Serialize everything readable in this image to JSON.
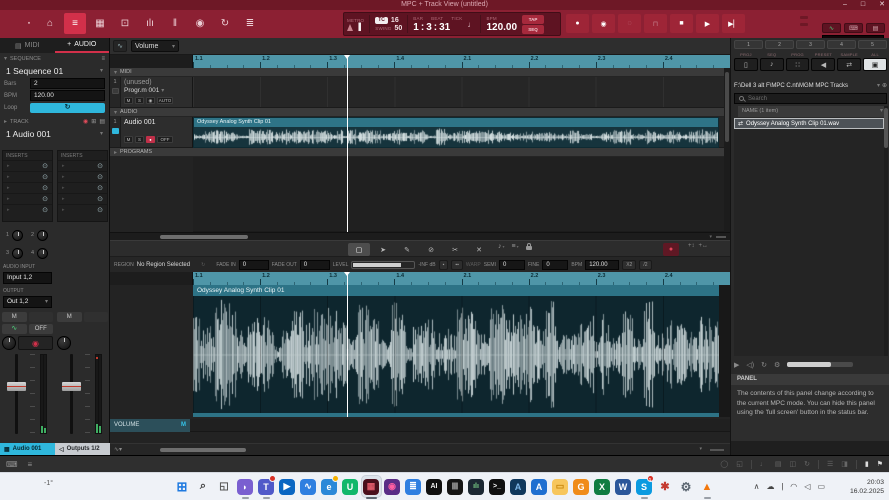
{
  "window": {
    "title": "MPC + Track View (untitled)",
    "minimize": "–",
    "maximize": "□",
    "close": "✕"
  },
  "toolbar": {
    "modes": [
      {
        "name": "main-menu",
        "glyph": "▪",
        "active": false
      },
      {
        "name": "home",
        "glyph": "⌂",
        "active": false
      },
      {
        "name": "track-view",
        "glyph": "≡",
        "active": true
      },
      {
        "name": "pad-grid",
        "glyph": "▦",
        "active": false
      },
      {
        "name": "sample-edit",
        "glyph": "⊡",
        "active": false
      },
      {
        "name": "step-sequencer",
        "glyph": "ılı",
        "active": false
      },
      {
        "name": "channel-mixer",
        "glyph": "‖",
        "active": false
      },
      {
        "name": "disc",
        "glyph": "◉",
        "active": false
      },
      {
        "name": "cycle",
        "glyph": "↻",
        "active": false
      },
      {
        "name": "track-stack",
        "glyph": "≣",
        "active": false
      }
    ],
    "transport": {
      "metro": "METRO",
      "tc": "TC",
      "tc_value": "16",
      "swing": "SWING",
      "swing_value": "50",
      "bar_label": "BAR",
      "beat_label": "BEAT",
      "tick_label": "TICK",
      "bar": "1",
      "beat": "3",
      "tick": "31",
      "bpm_label": "BPM",
      "bpm": "120.00",
      "tap": "TAP",
      "seq": "SEQ"
    },
    "transport_buttons": [
      {
        "name": "record",
        "glyph": "●",
        "dim": false
      },
      {
        "name": "overdub",
        "glyph": "◉",
        "dim": false
      },
      {
        "name": "count-in",
        "glyph": "◌",
        "dim": true
      },
      {
        "name": "punch",
        "glyph": "⊓",
        "dim": true
      },
      {
        "name": "stop",
        "glyph": "■",
        "dim": false
      },
      {
        "name": "play",
        "glyph": "▶",
        "dim": false
      },
      {
        "name": "play-start",
        "glyph": "▶▏",
        "dim": false
      }
    ],
    "right_toggles": [
      {
        "name": "audition",
        "glyph": "∿",
        "grn": true
      },
      {
        "name": "midi-keys",
        "glyph": "⌨",
        "grn": false
      },
      {
        "name": "pad-bank",
        "glyph": "▤",
        "grn": false
      }
    ]
  },
  "sidebar": {
    "tabs": [
      {
        "icon": "▤",
        "label": "MIDI",
        "active": false
      },
      {
        "icon": "+",
        "label": "AUDIO",
        "active": true
      }
    ],
    "sequence": {
      "header": "SEQUENCE",
      "name": "1 Sequence 01",
      "bars_label": "Bars",
      "bars": "2",
      "bpm_label": "BPM",
      "bpm": "120.00",
      "loop_label": "Loop"
    },
    "track": {
      "header": "TRACK",
      "name": "1 Audio 001"
    },
    "inserts_label": "INSERTS",
    "knob_labels": [
      "1",
      "2",
      "3",
      "4"
    ],
    "audio_input_label": "AUDIO INPUT",
    "audio_input": "Input 1,2",
    "output_label": "OUTPUT",
    "output": "Out 1,2",
    "mute": "M",
    "monitor_off": "OFF",
    "bottom_tabs": [
      {
        "icon": "▦",
        "label": "Audio 001"
      },
      {
        "icon": "◁",
        "label": "Outputs 1/2"
      }
    ]
  },
  "tracks": {
    "automation_param": "Volume",
    "ruler_ticks": [
      "1.1",
      "1.2",
      "1.3",
      "1.4",
      "2.1",
      "2.2",
      "2.3",
      "2.4"
    ],
    "midi_group": "MIDI",
    "audio_group": "AUDIO",
    "programs_group": "PROGRAMS",
    "midi_track": {
      "num": "1",
      "name": "(unused)",
      "program": "Progr.m 001",
      "mute": "M",
      "solo": "S",
      "auto": "AUTO"
    },
    "audio_track": {
      "num": "1",
      "name": "Audio 001",
      "mute": "M",
      "solo": "S",
      "off": "OFF"
    },
    "clip_name": "Odyssey Analog Synth Clip 01"
  },
  "editor": {
    "tools": [
      {
        "name": "marquee",
        "glyph": "▢",
        "active": true
      },
      {
        "name": "arrow",
        "glyph": "➤",
        "active": false
      },
      {
        "name": "pencil",
        "glyph": "✎",
        "active": false
      },
      {
        "name": "eraser",
        "glyph": "⊘",
        "active": false
      },
      {
        "name": "split",
        "glyph": "✂",
        "active": false
      },
      {
        "name": "mute",
        "glyph": "✕",
        "active": false
      }
    ],
    "region_label": "REGION",
    "region_value": "No Region Selected",
    "fade_in_label": "FADE IN",
    "fade_in": "0",
    "fade_out_label": "FADE OUT",
    "fade_out": "0",
    "level_label": "LEVEL",
    "level_db": "-INF dB",
    "warp_label": "WARP",
    "semi_label": "SEMI",
    "semi": "0",
    "fine_label": "FINE",
    "fine": "0",
    "bpm_label": "BPM",
    "bpm": "120.00",
    "x2": "X2",
    "div2": "/2",
    "volume_lane_label": "VOLUME",
    "volume_lane_m": "M"
  },
  "browser": {
    "pads": [
      "1",
      "2",
      "3",
      "4",
      "5"
    ],
    "filters": [
      {
        "label": "PROJ",
        "glyph": "▯",
        "active": false
      },
      {
        "label": "SEQ",
        "glyph": "♪",
        "active": false
      },
      {
        "label": "PROG",
        "glyph": "∷",
        "active": false
      },
      {
        "label": "PRESET",
        "glyph": "◀",
        "active": false
      },
      {
        "label": "SAMPLE",
        "glyph": "⇄",
        "active": false
      },
      {
        "label": "ALL",
        "glyph": "▣",
        "active": true
      }
    ],
    "path": "F:\\Dell 3 alt F\\MPC C.nt\\MGM MPC  Tracks",
    "search_placeholder": "Search",
    "list_header": "NAME (1 item)",
    "file_icon": "⇄",
    "file_name": "Odyssey Analog Synth Clip 01.wav",
    "player_icons": [
      {
        "name": "preview-play-icon",
        "glyph": "▶"
      },
      {
        "name": "preview-volume-icon",
        "glyph": "◁)"
      },
      {
        "name": "preview-loop-icon",
        "glyph": "↻"
      },
      {
        "name": "preview-settings-icon",
        "glyph": "⚙"
      }
    ],
    "panel_title": "PANEL",
    "panel_text": "The contents of this panel change according to the current MPC mode. You can hide this panel using the 'full screen' button in the status bar."
  },
  "statusbar": {
    "left_icons": [
      {
        "name": "virtual-keyboard-icon",
        "glyph": "⌨"
      },
      {
        "name": "mixer-strip-icon",
        "glyph": "≡"
      }
    ],
    "right_icons": [
      {
        "name": "sync-icon",
        "glyph": "◯",
        "bright": false
      },
      {
        "name": "window-icon",
        "glyph": "◱",
        "bright": false
      },
      {
        "name": "audio-icon",
        "glyph": "♩",
        "bright": false
      },
      {
        "name": "file-icon",
        "glyph": "▤",
        "bright": false
      },
      {
        "name": "split-icon",
        "glyph": "◫",
        "bright": false
      },
      {
        "name": "refresh-icon",
        "glyph": "↻",
        "bright": false
      },
      {
        "name": "list-icon",
        "glyph": "☰",
        "bright": false
      },
      {
        "name": "panel-icon",
        "glyph": "◨",
        "bright": false
      },
      {
        "name": "fullscreen-icon",
        "glyph": "▮",
        "bright": true
      },
      {
        "name": "flag-icon",
        "glyph": "⚑",
        "bright": true
      }
    ]
  },
  "taskbar": {
    "weather": "-1°",
    "apps": [
      {
        "name": "start",
        "glyph": "⊞",
        "fg": "#1f7ae0",
        "bg": "none",
        "fs": 13
      },
      {
        "name": "search",
        "glyph": "⌕",
        "fg": "#444",
        "bg": "none",
        "fs": 11
      },
      {
        "name": "task-view",
        "glyph": "◱",
        "fg": "#555",
        "bg": "none",
        "fs": 10
      },
      {
        "name": "copilot",
        "glyph": "◗",
        "fg": "#fff",
        "bg": "#7a5fd0",
        "open": true
      },
      {
        "name": "teams",
        "glyph": "T",
        "fg": "#fff",
        "bg": "#5059c9",
        "badge": "#d93025",
        "open": true
      },
      {
        "name": "movies-tv",
        "glyph": "▶",
        "fg": "#fff",
        "bg": "#0a66c2"
      },
      {
        "name": "mpc-beats",
        "glyph": "∿",
        "fg": "#fff",
        "bg": "#2f7fe0"
      },
      {
        "name": "edge",
        "glyph": "e",
        "fg": "#fff",
        "bg": "#2b88d8",
        "badge": "#f6b100"
      },
      {
        "name": "ultraviewer",
        "glyph": "U",
        "fg": "#fff",
        "bg": "#12b76a"
      },
      {
        "name": "mpc",
        "glyph": "▦",
        "fg": "#e05a6a",
        "bg": "#4a0f1c",
        "active": true,
        "open": true
      },
      {
        "name": "clipchamp",
        "glyph": "◉",
        "fg": "#ff5fa2",
        "bg": "#5b2d86"
      },
      {
        "name": "stack",
        "glyph": "≣",
        "fg": "#fff",
        "bg": "#2f7fe0"
      },
      {
        "name": "app-ai",
        "glyph": "AI",
        "fg": "#eee",
        "bg": "#101010",
        "fs": 7
      },
      {
        "name": "live",
        "glyph": "|||",
        "fg": "#fff",
        "bg": "#151515",
        "fs": 7
      },
      {
        "name": "analytics",
        "glyph": "ılı",
        "fg": "#7bd389",
        "bg": "#1c2833",
        "fs": 7
      },
      {
        "name": "terminal",
        "glyph": ">_",
        "fg": "#fff",
        "bg": "#101010",
        "fs": 7
      },
      {
        "name": "autodesk-a",
        "glyph": "A",
        "fg": "#7db6e8",
        "bg": "#10385c"
      },
      {
        "name": "autodesk-a3",
        "glyph": "A",
        "fg": "#fff",
        "bg": "#1f6fd0"
      },
      {
        "name": "folder",
        "glyph": "▭",
        "fg": "#c8860a",
        "bg": "#f7c65c"
      },
      {
        "name": "goldwave",
        "glyph": "G",
        "fg": "#fff",
        "bg": "#f08c1a"
      },
      {
        "name": "excel",
        "glyph": "X",
        "fg": "#fff",
        "bg": "#107c41"
      },
      {
        "name": "word",
        "glyph": "W",
        "fg": "#fff",
        "bg": "#2b579a"
      },
      {
        "name": "skype",
        "glyph": "S",
        "fg": "#fff",
        "bg": "#0a9ae0",
        "badge": "#d93025",
        "badge_text": "1",
        "open": true
      },
      {
        "name": "paint-red",
        "glyph": "✱",
        "fg": "#c43a2f",
        "bg": "none",
        "fs": 11
      },
      {
        "name": "settings",
        "glyph": "⚙",
        "fg": "#5a6570",
        "bg": "none",
        "fs": 12
      },
      {
        "name": "vlc",
        "glyph": "▲",
        "fg": "#f2770c",
        "bg": "none",
        "fs": 11,
        "open": true
      }
    ],
    "tray": [
      {
        "name": "tray-chevron-icon",
        "glyph": "∧"
      },
      {
        "name": "onedrive-icon",
        "glyph": "☁"
      },
      {
        "name": "mic-icon",
        "glyph": "ļ"
      },
      {
        "name": "wifi-icon",
        "glyph": "◠"
      },
      {
        "name": "volume-icon",
        "glyph": "◁"
      },
      {
        "name": "battery-icon",
        "glyph": "▭"
      }
    ],
    "time": "20:03",
    "date": "16.02.2025"
  }
}
